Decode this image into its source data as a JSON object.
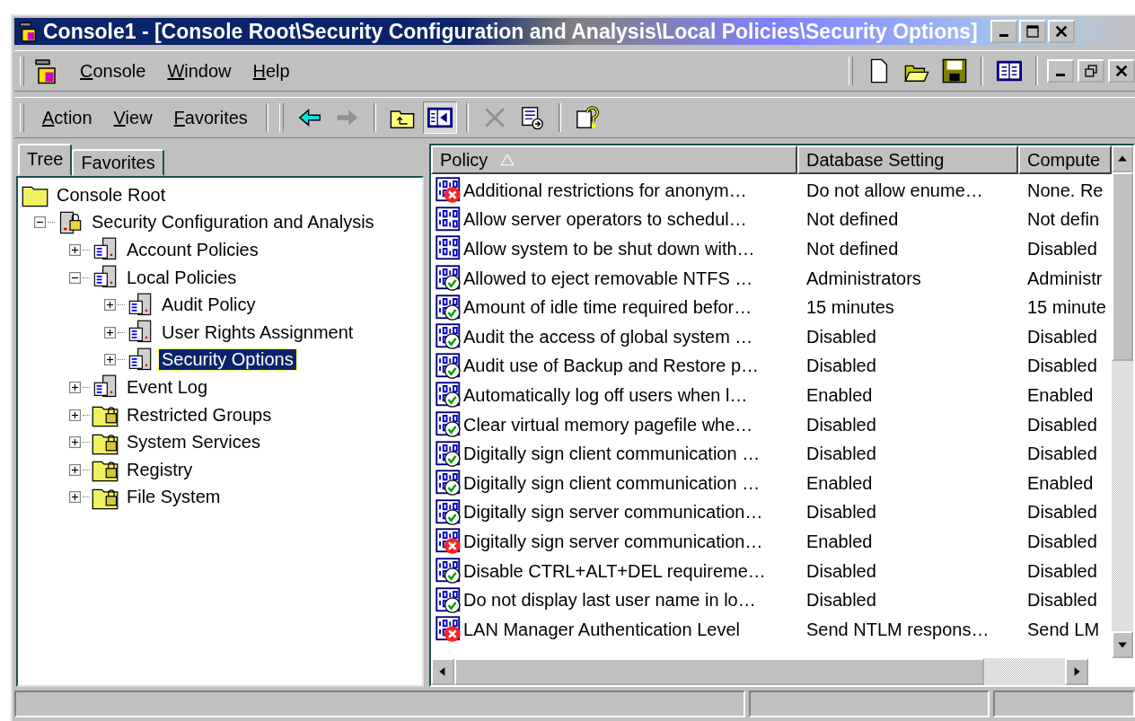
{
  "window": {
    "title": "Console1 - [Console Root\\Security Configuration and Analysis\\Local Policies\\Security Options]"
  },
  "menu": [
    "Console",
    "Window",
    "Help"
  ],
  "action_menu": [
    "Action",
    "View",
    "Favorites"
  ],
  "tabs": [
    {
      "label": "Tree",
      "selected": true
    },
    {
      "label": "Favorites",
      "selected": false
    }
  ],
  "tree": [
    {
      "label": "Console Root",
      "kind": "folder",
      "selected": false,
      "children": [
        {
          "label": "Security Configuration and Analysis",
          "kind": "database",
          "expanded": true,
          "selected": false,
          "children": [
            {
              "label": "Account Policies",
              "kind": "policy",
              "expanded": false,
              "selected": false
            },
            {
              "label": "Local Policies",
              "kind": "policy",
              "expanded": true,
              "selected": false,
              "children": [
                {
                  "label": "Audit Policy",
                  "kind": "policy",
                  "expanded": false,
                  "selected": false
                },
                {
                  "label": "User Rights Assignment",
                  "kind": "policy",
                  "expanded": false,
                  "selected": false
                },
                {
                  "label": "Security Options",
                  "kind": "policy",
                  "expanded": false,
                  "selected": true
                }
              ]
            },
            {
              "label": "Event Log",
              "kind": "policy",
              "expanded": false,
              "selected": false
            },
            {
              "label": "Restricted Groups",
              "kind": "locked-folder",
              "expanded": false,
              "selected": false
            },
            {
              "label": "System Services",
              "kind": "locked-folder",
              "expanded": false,
              "selected": false
            },
            {
              "label": "Registry",
              "kind": "locked-folder",
              "expanded": false,
              "selected": false
            },
            {
              "label": "File System",
              "kind": "locked-folder",
              "expanded": false,
              "selected": false
            }
          ]
        }
      ]
    }
  ],
  "table": {
    "columns": [
      {
        "label": "Policy",
        "sorted": true
      },
      {
        "label": "Database Setting",
        "sorted": false
      },
      {
        "label": "Compute",
        "sorted": false
      }
    ],
    "rows": [
      {
        "kind": "mismatch",
        "policy": "Additional restrictions for anonym…",
        "database": "Do not allow enume…",
        "computer": "None. Re"
      },
      {
        "kind": "undefined",
        "policy": "Allow server operators to schedul…",
        "database": "Not defined",
        "computer": "Not defin"
      },
      {
        "kind": "undefined",
        "policy": "Allow system to be shut down with…",
        "database": "Not defined",
        "computer": "Disabled"
      },
      {
        "kind": "match",
        "policy": "Allowed to eject removable NTFS …",
        "database": "Administrators",
        "computer": "Administr"
      },
      {
        "kind": "match",
        "policy": "Amount of idle time required befor…",
        "database": "15 minutes",
        "computer": "15 minute"
      },
      {
        "kind": "match",
        "policy": "Audit the access of global system …",
        "database": "Disabled",
        "computer": "Disabled"
      },
      {
        "kind": "match",
        "policy": "Audit use of Backup and Restore p…",
        "database": "Disabled",
        "computer": "Disabled"
      },
      {
        "kind": "match",
        "policy": "Automatically log off users when l…",
        "database": "Enabled",
        "computer": "Enabled"
      },
      {
        "kind": "match",
        "policy": "Clear virtual memory pagefile whe…",
        "database": "Disabled",
        "computer": "Disabled"
      },
      {
        "kind": "match",
        "policy": "Digitally sign client communication …",
        "database": "Disabled",
        "computer": "Disabled"
      },
      {
        "kind": "match",
        "policy": "Digitally sign client communication …",
        "database": "Enabled",
        "computer": "Enabled"
      },
      {
        "kind": "match",
        "policy": "Digitally sign server communication…",
        "database": "Disabled",
        "computer": "Disabled"
      },
      {
        "kind": "mismatch",
        "policy": "Digitally sign server communication…",
        "database": "Enabled",
        "computer": "Disabled"
      },
      {
        "kind": "match",
        "policy": "Disable CTRL+ALT+DEL requireme…",
        "database": "Disabled",
        "computer": "Disabled"
      },
      {
        "kind": "match",
        "policy": "Do not display last user name in lo…",
        "database": "Disabled",
        "computer": "Disabled"
      },
      {
        "kind": "mismatch",
        "policy": "LAN Manager Authentication Level",
        "database": "Send NTLM respons…",
        "computer": "Send LM"
      }
    ]
  }
}
